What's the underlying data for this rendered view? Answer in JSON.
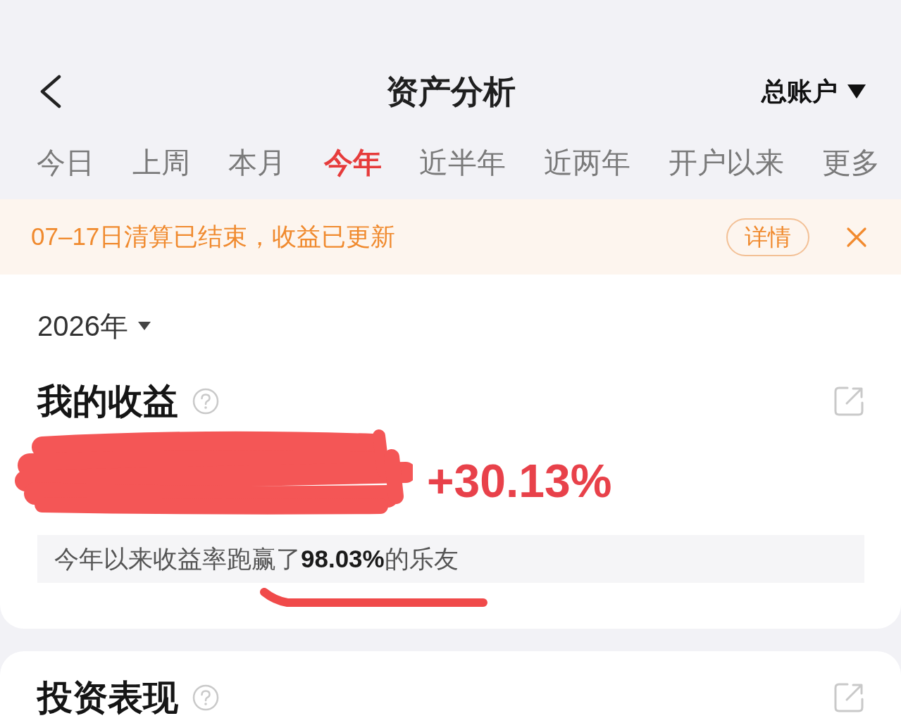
{
  "header": {
    "title": "资产分析",
    "account": "总账户"
  },
  "tabs": [
    {
      "label": "今日",
      "selected": false
    },
    {
      "label": "上周",
      "selected": false
    },
    {
      "label": "本月",
      "selected": false
    },
    {
      "label": "今年",
      "selected": true
    },
    {
      "label": "近半年",
      "selected": false
    },
    {
      "label": "近两年",
      "selected": false
    },
    {
      "label": "开户以来",
      "selected": false
    },
    {
      "label": "更多",
      "selected": false
    }
  ],
  "notice": {
    "text": "07–17日清算已结束，收益已更新",
    "button": "详情",
    "dismissible": true
  },
  "year": {
    "label": "2026年"
  },
  "income": {
    "title": "我的收益",
    "amount_redacted": true,
    "return": "+30.13%",
    "ranking": "今年以来收益率跑赢了**98.03%**的乐友",
    "ranking_underlined": true
  },
  "performance": {
    "title": "投资表现"
  }
}
